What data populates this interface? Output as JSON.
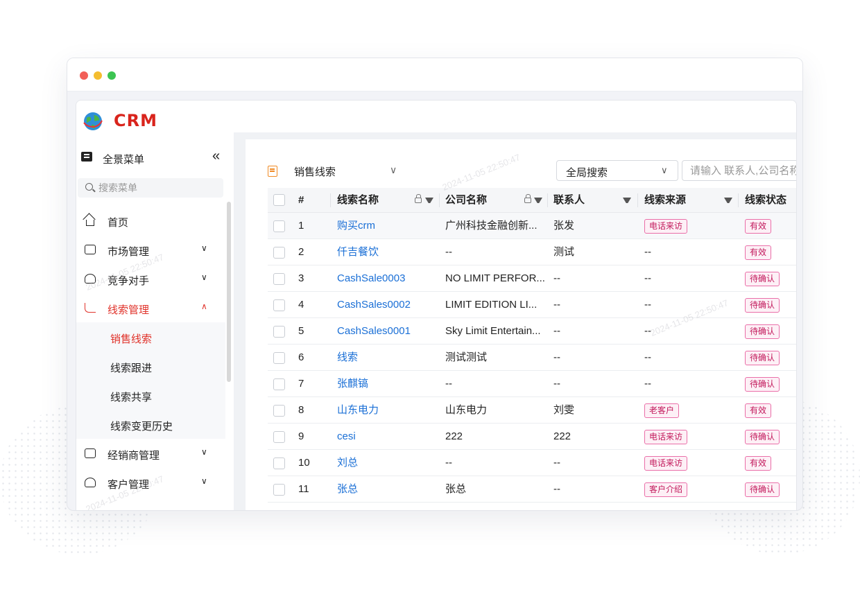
{
  "app": {
    "brand": "CRM",
    "watermarks": [
      "2024-11-05 22:50:47",
      "2024-11-05 22:50:47",
      "2024-11-05 22:50:47",
      "2024-11-05 22:50:47"
    ]
  },
  "sidebar": {
    "title": "全景菜单",
    "collapse_icon": "«",
    "search_placeholder": "搜索菜单",
    "items": [
      {
        "label": "首页",
        "icon": "home-icon"
      },
      {
        "label": "市场管理",
        "icon": "market-icon",
        "chevron": "∨"
      },
      {
        "label": "竞争对手",
        "icon": "competitor-icon",
        "chevron": "∨"
      },
      {
        "label": "线索管理",
        "icon": "lead-icon",
        "chevron": "∧"
      },
      {
        "label": "经销商管理",
        "icon": "dealer-icon",
        "chevron": "∨"
      },
      {
        "label": "客户管理",
        "icon": "customer-icon",
        "chevron": "∨"
      }
    ],
    "sub_items": [
      {
        "label": "销售线索"
      },
      {
        "label": "线索跟进"
      },
      {
        "label": "线索共享"
      },
      {
        "label": "线索变更历史"
      }
    ]
  },
  "main": {
    "page_title": "销售线索",
    "page_chevron": "∨",
    "global_search_select": "全局搜索",
    "global_search_chevron": "∨",
    "global_search_placeholder": "请输入 联系人,公司名称"
  },
  "table": {
    "columns": [
      "#",
      "线索名称",
      "公司名称",
      "联系人",
      "线索来源",
      "线索状态"
    ],
    "rows": [
      {
        "num": "1",
        "name": "购买crm",
        "company": "广州科技金融创新...",
        "contact": "张发",
        "source": "电话来访",
        "status": "有效"
      },
      {
        "num": "2",
        "name": "仟吉餐饮",
        "company": "--",
        "contact": "测试",
        "source": "--",
        "status": "有效"
      },
      {
        "num": "3",
        "name": "CashSale0003",
        "company": "NO LIMIT PERFOR...",
        "contact": "--",
        "source": "--",
        "status": "待确认"
      },
      {
        "num": "4",
        "name": "CashSales0002",
        "company": "LIMIT EDITION LI...",
        "contact": "--",
        "source": "--",
        "status": "待确认"
      },
      {
        "num": "5",
        "name": "CashSales0001",
        "company": "Sky Limit Entertain...",
        "contact": "--",
        "source": "--",
        "status": "待确认"
      },
      {
        "num": "6",
        "name": "线索",
        "company": "测试测试",
        "contact": "--",
        "source": "--",
        "status": "待确认"
      },
      {
        "num": "7",
        "name": "张麒镐",
        "company": "--",
        "contact": "--",
        "source": "--",
        "status": "待确认"
      },
      {
        "num": "8",
        "name": "山东电力",
        "company": "山东电力",
        "contact": "刘雯",
        "source": "老客户",
        "status": "有效"
      },
      {
        "num": "9",
        "name": "cesi",
        "company": "222",
        "contact": "222",
        "source": "电话来访",
        "status": "待确认"
      },
      {
        "num": "10",
        "name": "刘总",
        "company": "--",
        "contact": "--",
        "source": "电话来访",
        "status": "有效"
      },
      {
        "num": "11",
        "name": "张总",
        "company": "张总",
        "contact": "--",
        "source": "客户介绍",
        "status": "待确认"
      }
    ]
  },
  "colors": {
    "brand_red": "#d9241c",
    "active_red": "#e0322a",
    "link_blue": "#1a6fd6",
    "tag_pink": "#c2185b",
    "page_icon_orange": "#f08a24"
  }
}
